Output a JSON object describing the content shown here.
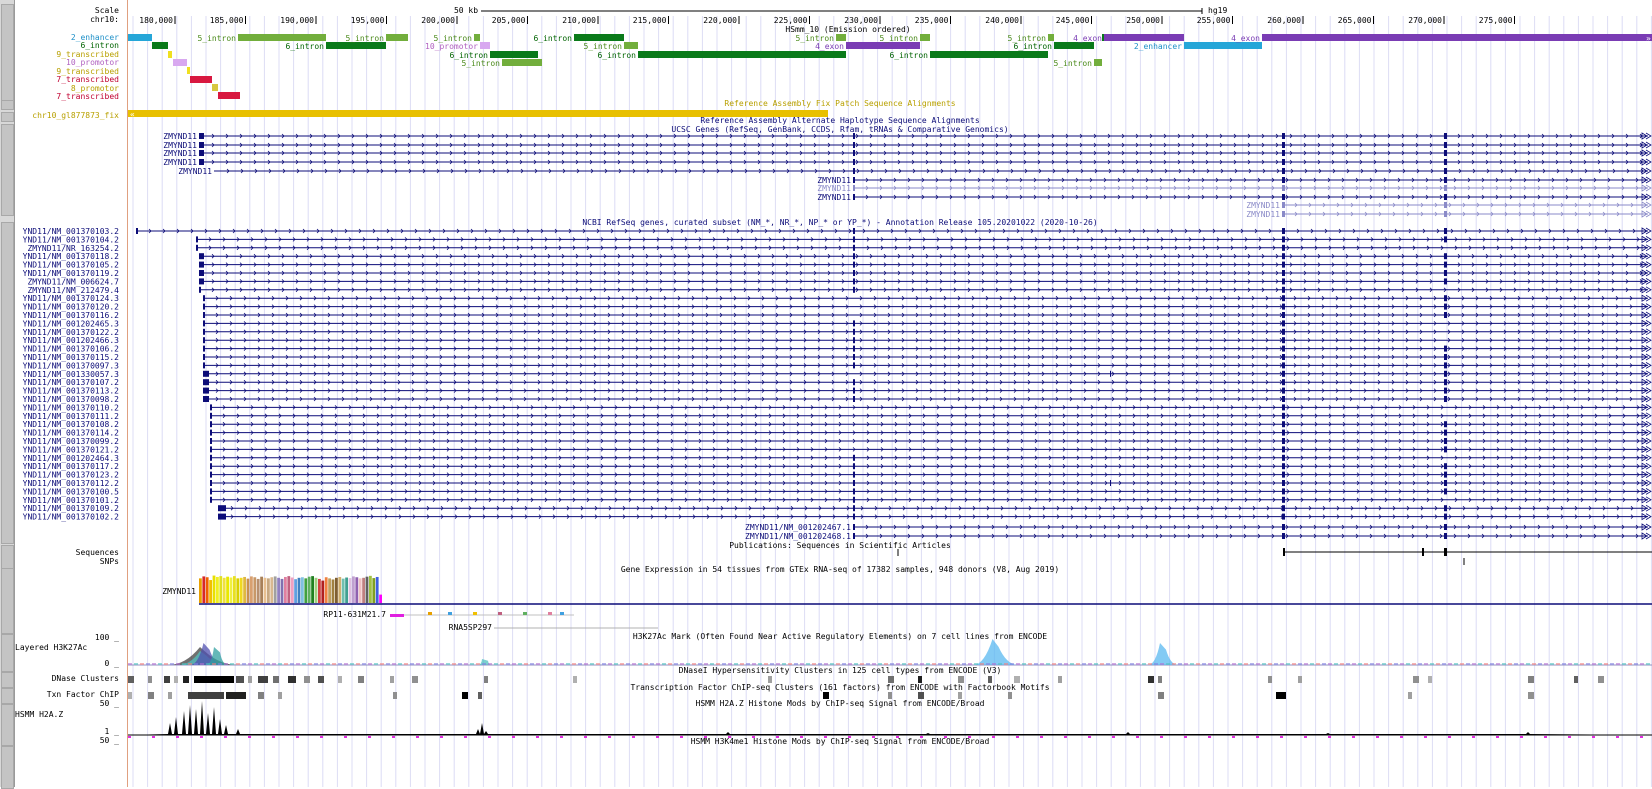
{
  "header": {
    "scale_label": "Scale",
    "chrom_label": "chr10:",
    "scale_bar_text": "50 kb",
    "assembly": "hg19",
    "positions": [
      "180,000",
      "185,000",
      "190,000",
      "195,000",
      "200,000",
      "205,000",
      "210,000",
      "215,000",
      "220,000",
      "225,000",
      "230,000",
      "235,000",
      "240,000",
      "245,000",
      "250,000",
      "255,000",
      "260,000",
      "265,000",
      "270,000",
      "275,000"
    ]
  },
  "hmm_track": {
    "title": "HSmm_10 (Emission ordered)",
    "left_labels": [
      {
        "text": "2_enhancer",
        "color": "#1e90c8"
      },
      {
        "text": "6_intron",
        "color": "#006400"
      },
      {
        "text": "9_transcribed",
        "color": "#b8a000"
      },
      {
        "text": "10_promotor",
        "color": "#b060c0"
      },
      {
        "text": "9_transcribed",
        "color": "#b8a000"
      },
      {
        "text": "7_transcribed",
        "color": "#c00030"
      },
      {
        "text": "8_promotor",
        "color": "#b8a000"
      },
      {
        "text": "7_transcribed",
        "color": "#c00030"
      }
    ],
    "block_labels": [
      "5_intron",
      "6_intron",
      "5_intron",
      "5_intron",
      "10_promotor",
      "6_intron",
      "5_intron",
      "5_intron",
      "6_intron",
      "6_intron",
      "5_intron",
      "4_exon",
      "5_intron",
      "6_intron",
      "5_intron",
      "6_intron",
      "5_intron",
      "6_intron",
      "4_exon",
      "2_enhancer",
      "4_exon",
      "5_intron"
    ],
    "colors": {
      "enhancer": "#25a6d8",
      "intron5": "#72ae3c",
      "intron6": "#0a7a1a",
      "exon4": "#7a3cb4",
      "promotor10": "#d8a8f0",
      "transcribed9": "#f0e020",
      "transcribed7": "#d81840",
      "promotor8": "#d8c840"
    }
  },
  "fix_patch": {
    "title": "Reference Assembly Fix Patch Sequence Alignments",
    "label": "chr10_gl877873_fix",
    "color": "#e8c000"
  },
  "alt_haplo": {
    "title": "Reference Assembly Alternate Haplotype Sequence Alignments"
  },
  "ucsc_genes": {
    "title": "UCSC Genes (RefSeq, GenBank, CCDS, Rfam, tRNAs & Comparative Genomics)",
    "gene_name": "ZMYND11",
    "color": "#0c0c78",
    "light_color": "#8a8ac8"
  },
  "refseq": {
    "title": "NCBI RefSeq genes, curated subset (NM_*, NR_*, NP_* or YP_*) - Annotation Release 105.20201022 (2020-10-26)",
    "labels": [
      "YND11/NM_001370103.2",
      "YND11/NM_001370104.2",
      "ZMYND11/NR_163254.2",
      "YND11/NM_001370118.2",
      "YND11/NM_001370105.2",
      "YND11/NM_001370119.2",
      "ZMYND11/NM_006624.7",
      "ZMYND11/NM_212479.4",
      "YND11/NM_001370124.3",
      "YND11/NM_001370120.2",
      "YND11/NM_001370116.2",
      "YND11/NM_001202465.3",
      "YND11/NM_001370122.2",
      "YND11/NM_001202466.3",
      "YND11/NM_001370106.2",
      "YND11/NM_001370115.2",
      "YND11/NM_001370097.3",
      "YND11/NM_001330057.3",
      "YND11/NM_001370107.2",
      "YND11/NM_001370113.2",
      "YND11/NM_001370098.2",
      "YND11/NM_001370110.2",
      "YND11/NM_001370111.2",
      "YND11/NM_001370108.2",
      "YND11/NM_001370114.2",
      "YND11/NM_001370099.2",
      "YND11/NM_001370121.2",
      "YND11/NM_001202464.3",
      "YND11/NM_001370117.2",
      "YND11/NM_001370123.2",
      "YND11/NM_001370112.2",
      "YND11/NM_001370100.5",
      "YND11/NM_001370101.2",
      "YND11/NM_001370109.2",
      "YND11/NM_001370102.2"
    ],
    "extra_labels": [
      "ZMYND11/NM_001202467.1",
      "ZMYND11/NM_001202468.1"
    ]
  },
  "publications": {
    "title": "Publications: Sequences in Scientific Articles",
    "label1": "Sequences",
    "label2": "SNPs"
  },
  "gtex": {
    "title": "Gene Expression in 54 tissues from GTEx RNA-seq of 17382 samples, 948 donors (V8, Aug 2019)",
    "gene_label": "ZMYND11",
    "bar_heights": [
      0.88,
      0.95,
      0.92,
      0.82,
      0.98,
      0.93,
      0.96,
      0.9,
      0.94,
      0.91,
      0.96,
      0.88,
      0.9,
      0.93,
      0.87,
      0.95,
      0.92,
      0.86,
      0.94,
      0.9,
      0.88,
      0.92,
      0.95,
      0.9,
      0.86,
      0.93,
      0.96,
      0.91,
      0.85,
      0.9,
      0.92,
      0.88,
      0.94,
      0.96,
      0.9,
      0.86,
      0.8,
      0.92,
      0.88,
      0.84,
      0.9,
      0.93,
      0.87,
      0.91,
      0.89,
      0.95,
      0.92,
      0.88,
      0.9,
      0.94,
      0.97,
      0.89,
      0.93,
      0.3
    ],
    "bar_colors": [
      "#e8a000",
      "#d82828",
      "#f06000",
      "#f0c000",
      "#e8e000",
      "#f0f020",
      "#e0e020",
      "#f0e040",
      "#e8e800",
      "#f0f040",
      "#e8e020",
      "#d8d000",
      "#f0d820",
      "#e0b840",
      "#c89050",
      "#d8a070",
      "#c89868",
      "#b89070",
      "#a88058",
      "#e8c090",
      "#c8a880",
      "#d8b890",
      "#a0a0a0",
      "#9080c0",
      "#8070b0",
      "#e080a0",
      "#c06080",
      "#f0a0c0",
      "#60a0e0",
      "#4080c0",
      "#80c0e0",
      "#40a040",
      "#60b060",
      "#208020",
      "#a0d080",
      "#d04040",
      "#b02020",
      "#f08040",
      "#c0a060",
      "#a08040",
      "#806030",
      "#d0b070",
      "#70c0b0",
      "#40a090",
      "#e0c0e0",
      "#c0a0d0",
      "#9060b0",
      "#f0c0c0",
      "#c08080",
      "#606060",
      "#a0c040",
      "#80a020",
      "#4060e0",
      "#ff00ff"
    ],
    "rp_label": "RP11-631M21.7",
    "rna_label": "RNA5SP297"
  },
  "h3k27ac": {
    "title": "H3K27Ac Mark (Often Found Near Active Regulatory Elements) on 7 cell lines from ENCODE",
    "label": "Layered H3K27Ac",
    "ymax": "100 _",
    "ymin": "0 _"
  },
  "dnase": {
    "title": "DNaseI Hypersensitivity Clusters in 125 cell types from ENCODE (V3)",
    "label": "DNase Clusters"
  },
  "tfbs": {
    "title": "Transcription Factor ChIP-seq Clusters (161 factors) from ENCODE with Factorbook Motifs",
    "label": "Txn Factor ChIP"
  },
  "h2az": {
    "title": "HSMM H2A.Z Histone Mods by ChIP-seq Signal from ENCODE/Broad",
    "label": "HSMM H2A.Z",
    "ymax": "50 _",
    "ymin": "1 _"
  },
  "h3k4me1": {
    "title": "HSMM H3K4me1 Histone Mods by ChIP-seq Signal from ENCODE/Broad",
    "ymax": "50 _"
  }
}
